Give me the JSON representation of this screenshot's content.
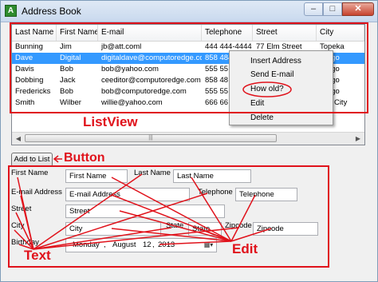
{
  "window": {
    "title": "Address Book",
    "app_icon_letter": "A",
    "min_glyph": "–",
    "max_glyph": "□",
    "close_glyph": "✕"
  },
  "listview": {
    "columns": [
      "Last Name",
      "First Name",
      "E-mail",
      "Telephone",
      "Street",
      "City"
    ],
    "rows": [
      [
        "Bunning",
        "Jim",
        "jb@att.coml",
        "444 444-4444",
        "77 Elm Street",
        "Topeka"
      ],
      [
        "Dave",
        "Digital",
        "digitaldave@computoredge.com",
        "858 484",
        "",
        "Diego"
      ],
      [
        "Davis",
        "Bob",
        "bob@yahoo.com",
        "555 55",
        "",
        "Diego"
      ],
      [
        "Dobbing",
        "Jack",
        "ceeditor@computoredge.com",
        "858 48",
        "",
        "Diego"
      ],
      [
        "Fredericks",
        "Bob",
        "bob@computoredge.com",
        "555 55",
        "",
        "Diego"
      ],
      [
        "Smith",
        "Wilber",
        "willie@yahoo.com",
        "666 66",
        "",
        "ake City"
      ]
    ],
    "selected_row": 1,
    "scroll_grip": "|||"
  },
  "context_menu": {
    "items": [
      "Insert Address",
      "Send E-mail",
      "How old?",
      "Edit",
      "Delete"
    ]
  },
  "form": {
    "add_button": "Add to List",
    "labels": {
      "first_name": "First Name",
      "last_name": "Last Name",
      "email": "E-mail Address",
      "telephone": "Telephone",
      "street": "Street",
      "city": "City",
      "state": "State",
      "zipcode": "Zipcode",
      "birthday": "Birthday"
    },
    "fields": {
      "first_name": "First Name",
      "last_name": "Last Name",
      "email": "E-mail Address",
      "telephone": "Telephone",
      "street": "Street",
      "city": "City",
      "state": "State",
      "zipcode": "Zipcode"
    },
    "birthday": {
      "weekday": "Monday",
      "sep1": ",",
      "month": "August",
      "day": "12",
      "sep2": ",",
      "year": "2013"
    },
    "calendar_icon_glyph": "▦▾"
  },
  "annotations": {
    "color": "#e0121b",
    "listview_label": "ListView",
    "button_label": "Button",
    "text_label": "Text",
    "edit_label": "Edit"
  }
}
